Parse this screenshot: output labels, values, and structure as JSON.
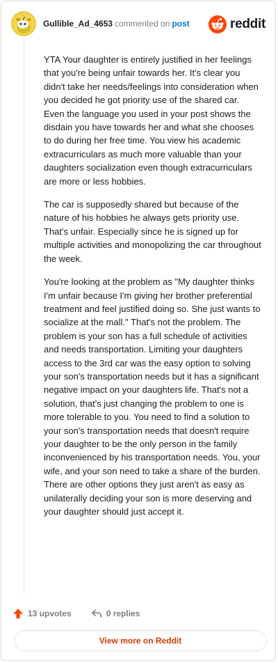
{
  "header": {
    "username": "Gullible_Ad_4653",
    "action_text": "commented on",
    "post_link": "post",
    "brand_name": "reddit"
  },
  "comment": {
    "paragraphs": [
      "YTA Your daughter is entirely justified in her feelings that you're being unfair towards her. It's clear you didn't take her needs/feelings into consideration when you decided he got priority use of the shared car. Even the language you used in your post shows the disdain you have towards her and what she chooses to do during her free time. You view his academic extracurriculars as much more valuable than your daughters socialization even though extracurriculars are more or less hobbies.",
      "The car is supposedly shared but because of the nature of his hobbies he always gets priority use. That's unfair. Especially since he is signed up for multiple activities and monopolizing the car throughout the week.",
      "You're looking at the problem as \"My daughter thinks I'm unfair because I'm giving her brother preferential treatment and feel justified doing so. She just wants to socialize at the mall.\" That's not the problem. The problem is your son has a full schedule of activities and needs transportation. Limiting your daughters access to the 3rd car was the easy option to solving your son's transportation needs but it has a significant negative impact on your daughters life. That's not a solution, that's just changing the problem to one is more tolerable to you. You need to find a solution to your son's transportation needs that doesn't require your daughter to be the only person in the family inconvenienced by his transportation needs. You, your wife, and your son need to take a share of the burden. There are other options they just aren't as easy as unilaterally deciding your son is more deserving and your daughter should just accept it."
    ]
  },
  "footer": {
    "upvotes": "13 upvotes",
    "replies": "0 replies",
    "view_more": "View more on Reddit"
  },
  "colors": {
    "accent_blue": "#0079d3",
    "reddit_orange": "#ff4500",
    "view_more_text": "#d93a00"
  },
  "icons": {
    "avatar": "snoo-avatar-icon",
    "brand": "reddit-logo-icon",
    "upvote": "upvote-arrow-icon",
    "reply": "reply-arrow-icon"
  }
}
